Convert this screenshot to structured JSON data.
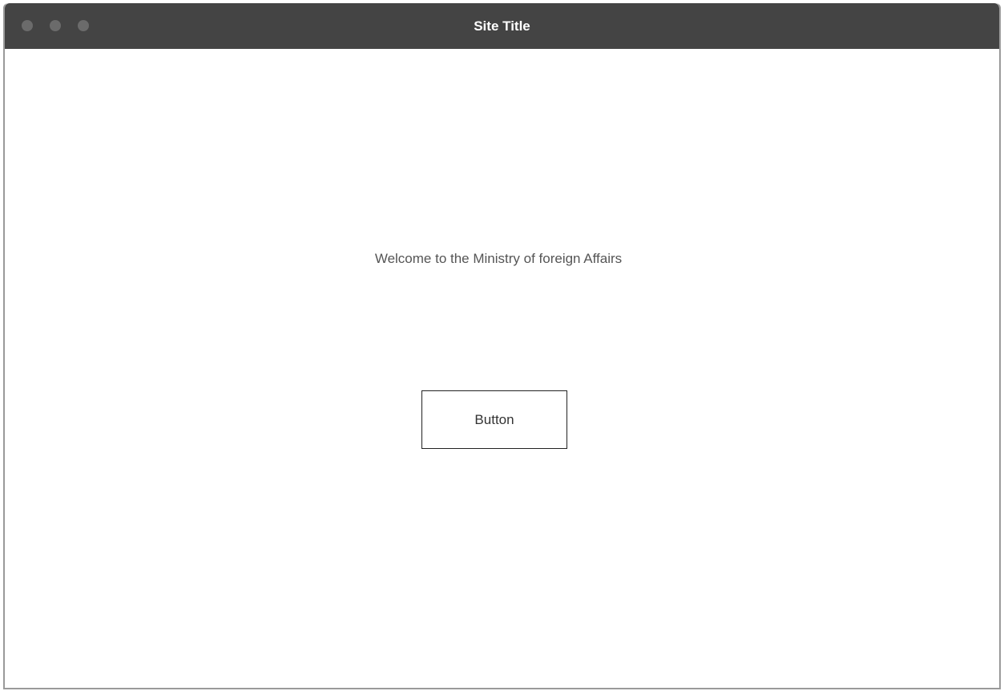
{
  "window": {
    "title": "Site Title",
    "controls": [
      "close-dot",
      "minimize-dot",
      "maximize-dot"
    ]
  },
  "main": {
    "welcome_text": "Welcome to the Ministry of foreign Affairs",
    "button_label": "Button"
  },
  "colors": {
    "titlebar": "#444444",
    "title_text": "#ffffff",
    "window_dots": "#6b6b6b",
    "body_text": "#555555",
    "button_border": "#222222"
  }
}
